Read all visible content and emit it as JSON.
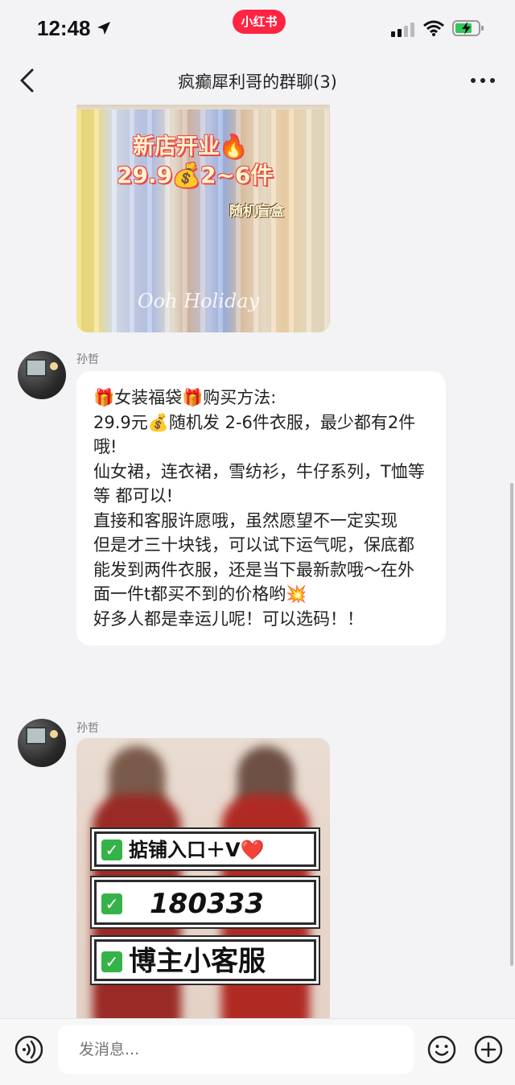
{
  "status_bar": {
    "time": "12:48",
    "app_badge": "小红书"
  },
  "nav": {
    "title": "疯癫犀利哥的群聊(3)"
  },
  "messages": [
    {
      "sender": "孙哲",
      "lines": [
        "🎁女装福袋🎁购买方法:",
        "29.9元💰随机发 2-6件衣服，最少都有2件哦!",
        "仙女裙，连衣裙，雪纺衫，牛仔系列，T恤等等 都可以!",
        "直接和客服许愿哦，虽然愿望不一定实现",
        "但是才三十块钱，可以试下运气呢，保底都能发到两件衣服，还是当下最新款哦～在外面一件t都买不到的价格哟💥",
        "好多人都是幸运儿呢！可以选码！！"
      ]
    },
    {
      "sender": "孙哲"
    }
  ],
  "image_top": {
    "line1": "新店开业🔥",
    "line2": "29.9💰2~6件",
    "line3": "随机盲盒",
    "watermark": "Ooh Holiday"
  },
  "image_bottom": {
    "tag1": "掂铺入口＋V❤️",
    "tag2": "180333",
    "tag3": "博主小客服"
  },
  "input": {
    "placeholder": "发消息..."
  },
  "colors": {
    "brand": "#ff2442",
    "bubble": "#ffffff",
    "background": "#f3f3f5",
    "check": "#35b34a"
  }
}
